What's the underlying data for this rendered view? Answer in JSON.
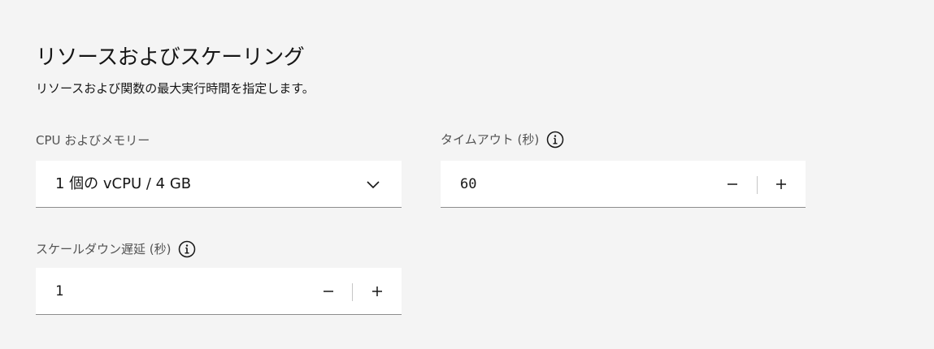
{
  "section": {
    "title": "リソースおよびスケーリング",
    "subtitle": "リソースおよび関数の最大実行時間を指定します。"
  },
  "cpu_memory": {
    "label": "CPU およびメモリー",
    "selected": "1 個の vCPU / 4 GB",
    "icon": "chevron-down-icon"
  },
  "timeout": {
    "label": "タイムアウト (秒)",
    "value": "60",
    "info_icon": "information-icon"
  },
  "scale_down_delay": {
    "label": "スケールダウン遅延 (秒)",
    "value": "1",
    "info_icon": "information-icon"
  },
  "colors": {
    "background": "#f4f4f4",
    "field_background": "#ffffff",
    "border": "#8d8d8d",
    "text": "#161616",
    "label": "#525252"
  }
}
